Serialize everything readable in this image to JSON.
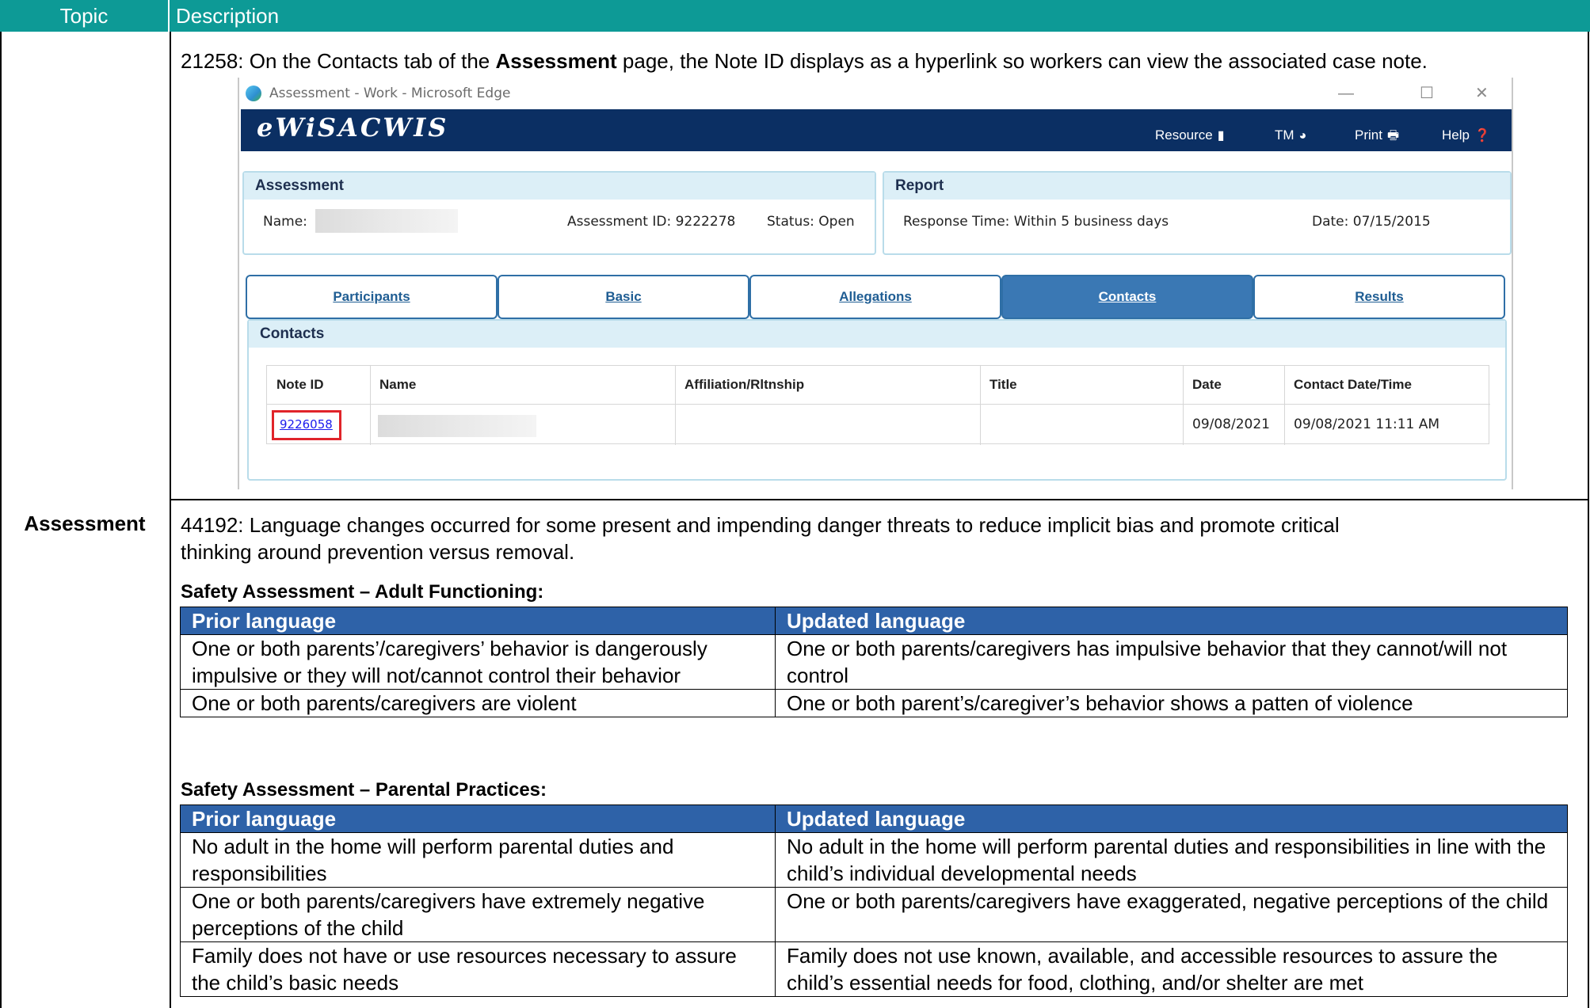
{
  "header": {
    "topic": "Topic",
    "description": "Description"
  },
  "topic_label": "Assessment",
  "item1": {
    "prefix": "21258: On the Contacts tab of the ",
    "bold": "Assessment",
    "suffix": " page, the Note ID displays as a hyperlink so workers can view the associated case note."
  },
  "screenshot": {
    "window_title": "Assessment - Work - Microsoft Edge",
    "window_buttons": [
      "—",
      "☐",
      "✕"
    ],
    "app_name": "eWiSACWIS",
    "menu": [
      {
        "label": "Resource",
        "icon": "book-icon",
        "glyph": "▮"
      },
      {
        "label": "TM",
        "icon": "globe-icon",
        "glyph": "◕"
      },
      {
        "label": "Print",
        "icon": "printer-icon",
        "glyph": "🖶"
      },
      {
        "label": "Help",
        "icon": "help-icon",
        "glyph": "❓"
      }
    ],
    "assessment_panel": {
      "title": "Assessment",
      "name_label": "Name:",
      "assessment_id": "Assessment ID:  9222278",
      "status": "Status:  Open"
    },
    "report_panel": {
      "title": "Report",
      "response_time": "Response Time:  Within 5 business days",
      "date": "Date:  07/15/2015"
    },
    "tabs": [
      {
        "label": "Participants",
        "active": false
      },
      {
        "label": "Basic",
        "active": false
      },
      {
        "label": "Allegations",
        "active": false
      },
      {
        "label": "Contacts",
        "active": true
      },
      {
        "label": "Results",
        "active": false
      }
    ],
    "contacts": {
      "title": "Contacts",
      "columns": [
        "Note ID",
        "Name",
        "Affiliation/Rltnship",
        "Title",
        "Date",
        "Contact Date/Time"
      ],
      "row": {
        "note_id": "9226058",
        "name": "",
        "affiliation": "",
        "title": "",
        "date": "09/08/2021",
        "contact_datetime": "09/08/2021 11:11 AM"
      }
    }
  },
  "item2": {
    "line1": "44192: Language changes occurred for some present and impending danger threats to reduce implicit bias and promote critical",
    "line2": "thinking around prevention versus removal."
  },
  "table_adult": {
    "heading": "Safety Assessment – Adult Functioning:",
    "col_prior": "Prior language",
    "col_updated": "Updated language",
    "rows": [
      {
        "prior": "One or both parents’/caregivers’ behavior is dangerously impulsive or they will not/cannot control their behavior",
        "updated": "One or both parents/caregivers has impulsive behavior that they cannot/will not control"
      },
      {
        "prior": "One or both parents/caregivers are violent",
        "updated": "One or both parent’s/caregiver’s behavior shows a patten of violence"
      }
    ]
  },
  "table_parental": {
    "heading": "Safety Assessment – Parental Practices:",
    "col_prior": "Prior language",
    "col_updated": "Updated language",
    "rows": [
      {
        "prior": "No adult in the home will perform parental duties and responsibilities",
        "updated": "No adult in the home will perform parental duties and responsibilities in line with the child’s individual developmental needs"
      },
      {
        "prior": "One or both parents/caregivers have extremely negative perceptions of the child",
        "updated": "One or both parents/caregivers have exaggerated, negative perceptions of the child"
      },
      {
        "prior": "Family does not have or use resources necessary to assure the child’s basic needs",
        "updated": "Family does not use known, available, and accessible resources to assure the child’s essential needs for food, clothing, and/or shelter are met"
      }
    ]
  },
  "colors": {
    "header_teal": "#0d9a96",
    "table_header_blue": "#2e62a8",
    "app_navy": "#0b2f63",
    "link_blue": "#1a1aee",
    "highlight_red": "#e0242a"
  }
}
